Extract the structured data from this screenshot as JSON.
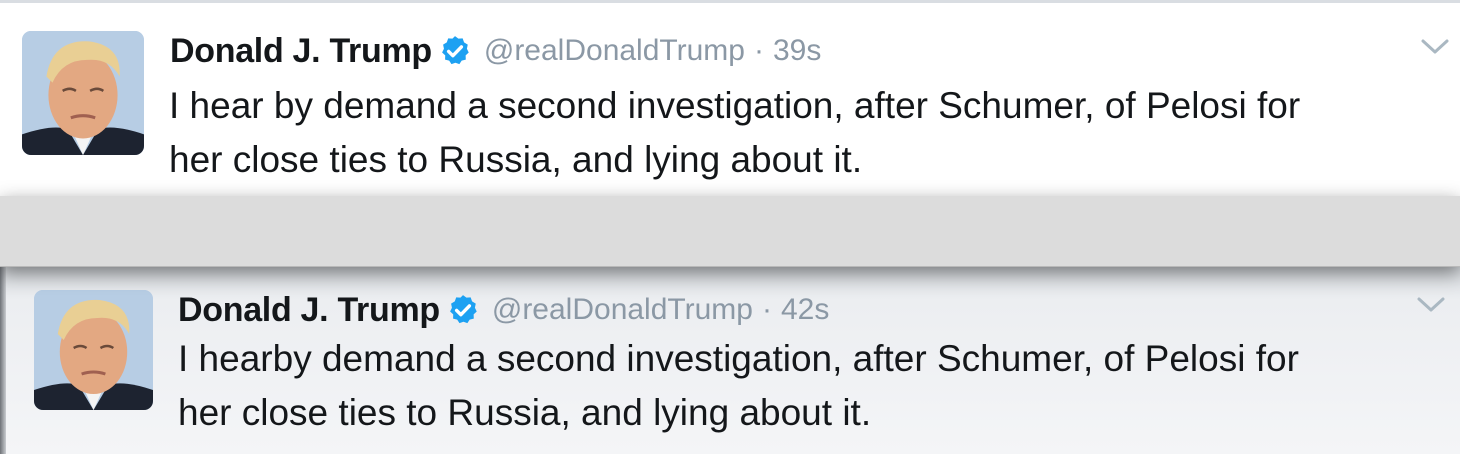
{
  "tweets": [
    {
      "display_name": "Donald J. Trump",
      "handle": "@realDonaldTrump",
      "separator": "·",
      "timestamp": "39s",
      "text_line_1": "I hear by demand a second investigation, after Schumer, of Pelosi for",
      "text_line_2": "her close ties to Russia, and lying about it.",
      "verified_icon": "verified-badge-icon",
      "menu_icon": "chevron-down-icon"
    },
    {
      "display_name": "Donald J. Trump",
      "handle": "@realDonaldTrump",
      "separator": "·",
      "timestamp": "42s",
      "text_line_1": "I hearby demand a second investigation, after Schumer, of Pelosi for",
      "text_line_2": "her close ties to Russia, and lying about it.",
      "verified_icon": "verified-badge-icon",
      "menu_icon": "chevron-down-icon"
    }
  ],
  "colors": {
    "text": "#14171a",
    "secondary_text": "#8b98a5",
    "verified_blue": "#1da1f2",
    "separator_band": "#dcdcdc"
  }
}
